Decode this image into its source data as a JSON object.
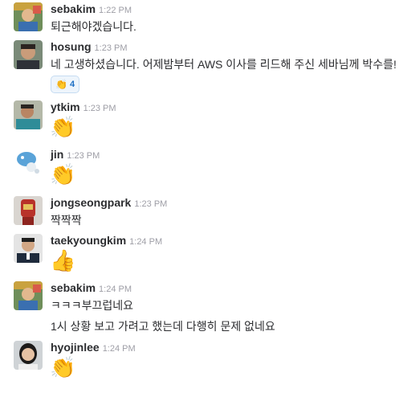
{
  "messages": [
    {
      "user": "sebakim",
      "time": "1:22 PM",
      "lines": [
        "퇴근해야겠습니다."
      ]
    },
    {
      "user": "hosung",
      "time": "1:23 PM",
      "lines": [
        "네 고생하셨습니다. 어제밤부터 AWS 이사를 리드해 주신 세바님께 박수를!"
      ],
      "reaction": {
        "emoji": "👏",
        "count": "4"
      }
    },
    {
      "user": "ytkim",
      "time": "1:23 PM",
      "emoji": "👏"
    },
    {
      "user": "jin",
      "time": "1:23 PM",
      "emoji": "👏"
    },
    {
      "user": "jongseongpark",
      "time": "1:23 PM",
      "lines": [
        "짝짝짝"
      ]
    },
    {
      "user": "taekyoungkim",
      "time": "1:24 PM",
      "emoji": "👍"
    },
    {
      "user": "sebakim",
      "time": "1:24 PM",
      "lines": [
        "ㅋㅋㅋ부끄럽네요",
        "1시 상황 보고 가려고 했는데 다행히 문제 없네요"
      ]
    },
    {
      "user": "hyojinlee",
      "time": "1:24 PM",
      "emoji": "👏"
    }
  ],
  "colors": {
    "name": "#2c2d30",
    "timestamp": "#9e9ea6",
    "reaction_bg": "#eef5fc",
    "reaction_border": "#c6dcf2",
    "reaction_count": "#1d6fc4"
  }
}
